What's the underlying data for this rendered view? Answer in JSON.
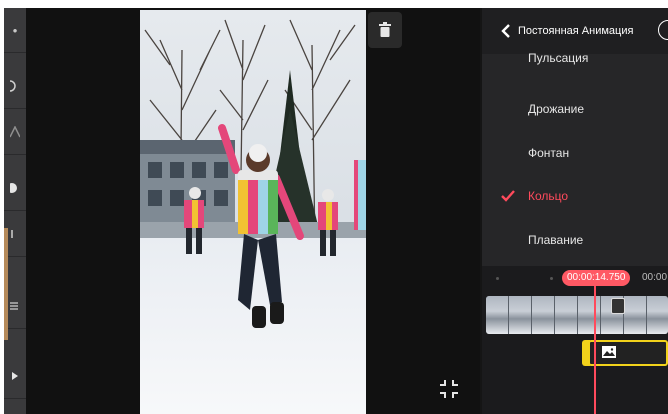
{
  "panel": {
    "title": "Постоянная Анимация"
  },
  "animations": [
    {
      "label": "Пульсация",
      "selected": false
    },
    {
      "label": "Дрожание",
      "selected": false
    },
    {
      "label": "Фонтан",
      "selected": false
    },
    {
      "label": "Кольцо",
      "selected": true
    },
    {
      "label": "Плавание",
      "selected": false
    }
  ],
  "timeline": {
    "current_time": "00:00:14.750",
    "next_time": "00:00"
  },
  "icons": {
    "back": "chevron-left-icon",
    "help": "help-circle-icon",
    "check": "check-icon",
    "delete": "trash-icon",
    "fullscreen": "exit-fullscreen-icon",
    "overlay": "image-icon"
  },
  "colors": {
    "accent": "#ff4a5c",
    "overlay_border": "#f2d21b",
    "panel_bg": "#262628",
    "toolbar_bg": "#3a3a3c"
  }
}
